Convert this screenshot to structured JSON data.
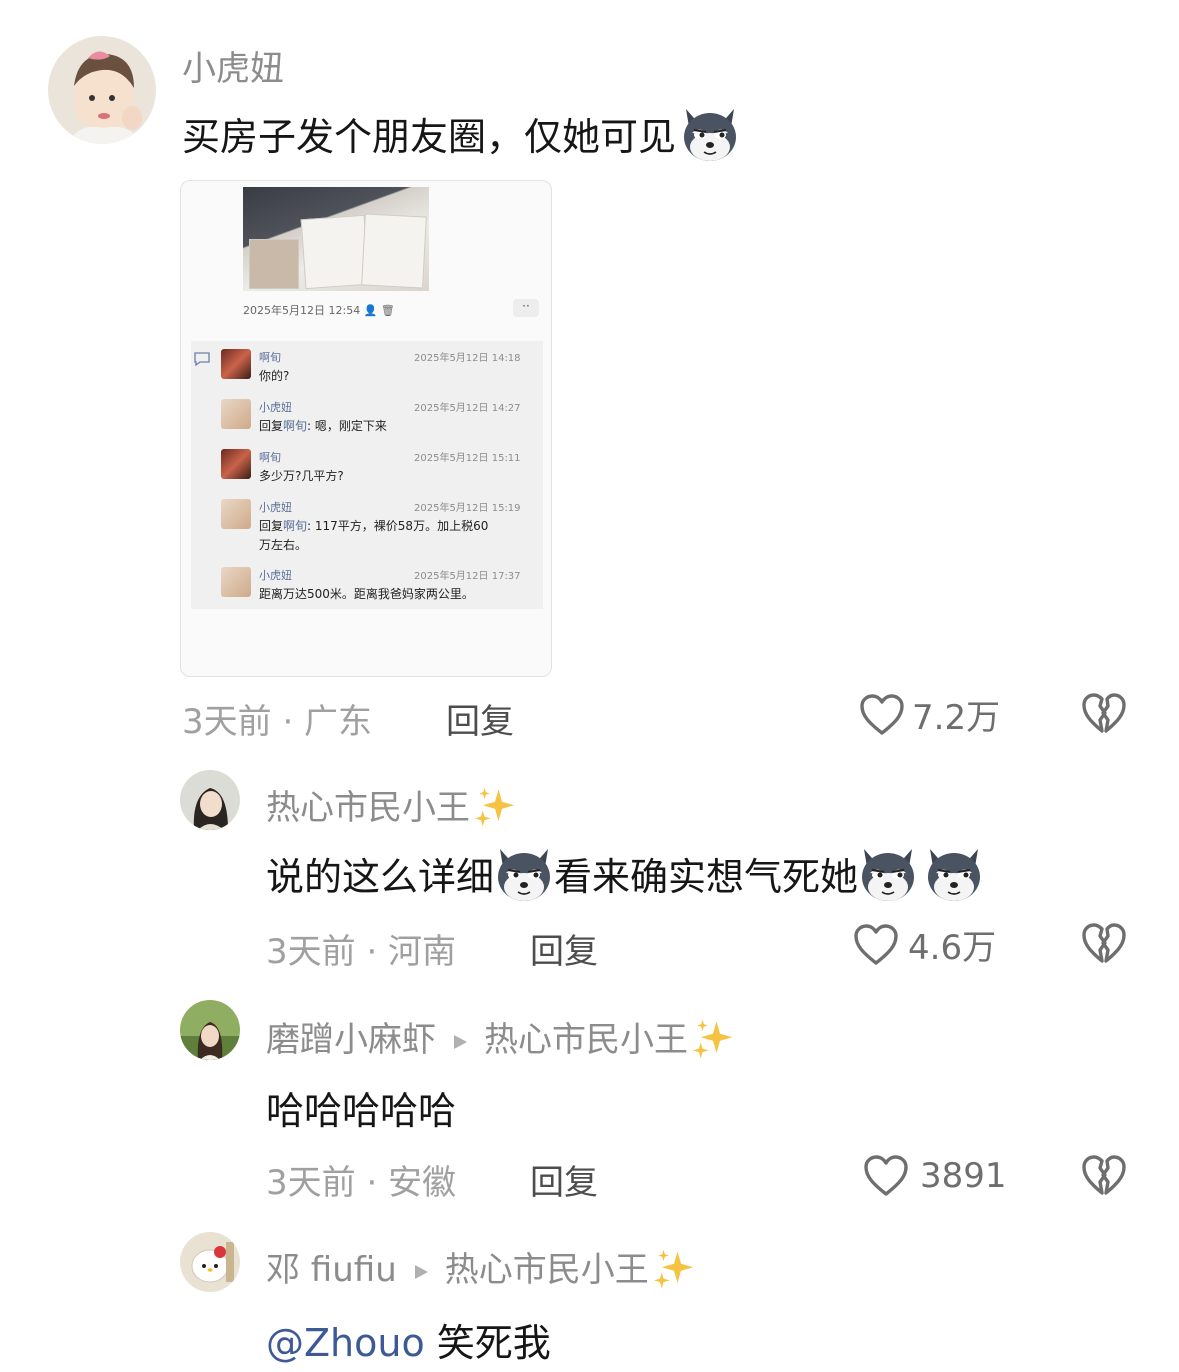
{
  "comments": [
    {
      "username": "小虎妞",
      "text": "买房子发个朋友圈，仅她可见",
      "time_location": "3天前 · 广东",
      "reply_label": "回复",
      "like_count": "7.2万"
    },
    {
      "username": "热心市民小王",
      "text_part1": "说的这么详细",
      "text_part2": "看来确实想气死她",
      "time_location": "3天前 · 河南",
      "reply_label": "回复",
      "like_count": "4.6万"
    },
    {
      "username": "磨蹭小麻虾",
      "reply_to": "热心市民小王",
      "text": "哈哈哈哈哈",
      "time_location": "3天前 · 安徽",
      "reply_label": "回复",
      "like_count": "3891"
    },
    {
      "username": "邓 fiufiu",
      "reply_to": "热心市民小王",
      "mention": "@Zhouo",
      "text": "笑死我"
    }
  ],
  "screenshot": {
    "post_date": "2025年5月12日 12:54",
    "more_label": "··",
    "comments": [
      {
        "name": "啊旬",
        "time": "2025年5月12日 14:18",
        "text": "你的?"
      },
      {
        "name": "小虎妞",
        "time": "2025年5月12日 14:27",
        "reply_prefix": "回复",
        "reply_name": "啊旬",
        "text": ": 嗯，刚定下来"
      },
      {
        "name": "啊旬",
        "time": "2025年5月12日 15:11",
        "text": "多少万?几平方?"
      },
      {
        "name": "小虎妞",
        "time": "2025年5月12日 15:19",
        "reply_prefix": "回复",
        "reply_name": "啊旬",
        "text": ": 117平方，裸价58万。加上税60",
        "text_line2": "万左右。"
      },
      {
        "name": "小虎妞",
        "time": "2025年5月12日 17:37",
        "text": "距离万达500米。距离我爸妈家两公里。"
      }
    ]
  },
  "icons": {
    "like": "heart-outline-icon",
    "dislike": "broken-heart-icon",
    "emoji": "husky-dog-emoji-icon",
    "sparkle": "sparkles-icon",
    "arrow": "reply-arrow-icon"
  }
}
